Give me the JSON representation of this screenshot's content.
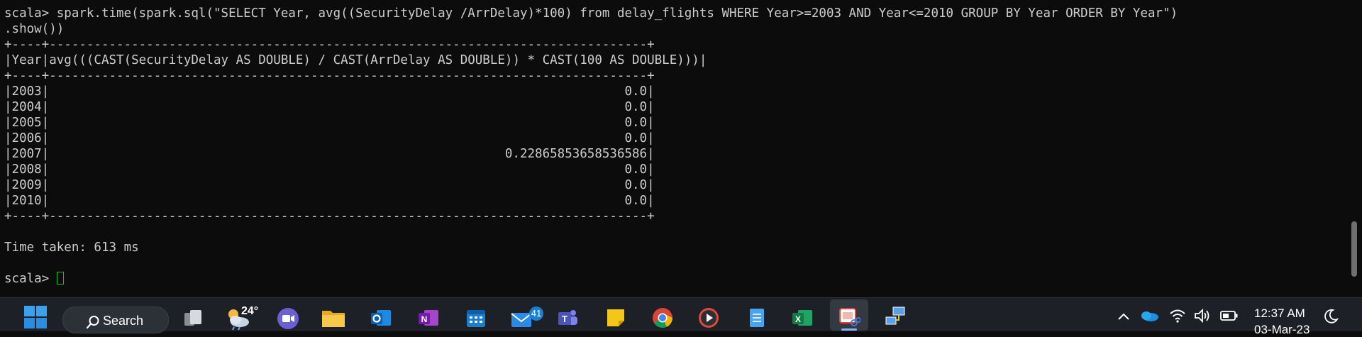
{
  "terminal": {
    "lines": [
      "scala> spark.time(spark.sql(\"SELECT Year, avg((SecurityDelay /ArrDelay)*100) from delay_flights WHERE Year>=2003 AND Year<=2010 GROUP BY Year ORDER BY Year\")",
      ".show())",
      "+----+--------------------------------------------------------------------------------+",
      "|Year|avg(((CAST(SecurityDelay AS DOUBLE) / CAST(ArrDelay AS DOUBLE)) * CAST(100 AS DOUBLE)))|",
      "+----+--------------------------------------------------------------------------------+",
      "|2003|                                                                             0.0|",
      "|2004|                                                                             0.0|",
      "|2005|                                                                             0.0|",
      "|2006|                                                                             0.0|",
      "|2007|                                                             0.22865853658536586|",
      "|2008|                                                                             0.0|",
      "|2009|                                                                             0.0|",
      "|2010|                                                                             0.0|",
      "+----+--------------------------------------------------------------------------------+",
      "",
      "Time taken: 613 ms",
      ""
    ],
    "prompt": "scala> ",
    "text_color": "#cccccc",
    "background": "#0c0c0c",
    "cursor_color": "#16c60c"
  },
  "taskbar": {
    "search_label": "Search",
    "weather_temp": "24°",
    "mail_badge": "41",
    "clock_time": "12:37 AM",
    "clock_date": "03-Mar-23",
    "apps": [
      "task-view-icon",
      "weather-icon",
      "meet-icon",
      "file-explorer-icon",
      "outlook-icon",
      "onenote-icon",
      "calendar-icon",
      "mail-icon",
      "teams-icon",
      "sticky-notes-icon",
      "chrome-icon",
      "media-player-icon",
      "notepad-icon",
      "excel-icon",
      "snipping-tool-icon",
      "network-app-icon"
    ],
    "tray_icons": [
      "chevron-up-icon",
      "onedrive-icon",
      "wifi-icon",
      "volume-icon",
      "battery-icon",
      "moon-icon"
    ],
    "accent": "#1a7fd1"
  }
}
